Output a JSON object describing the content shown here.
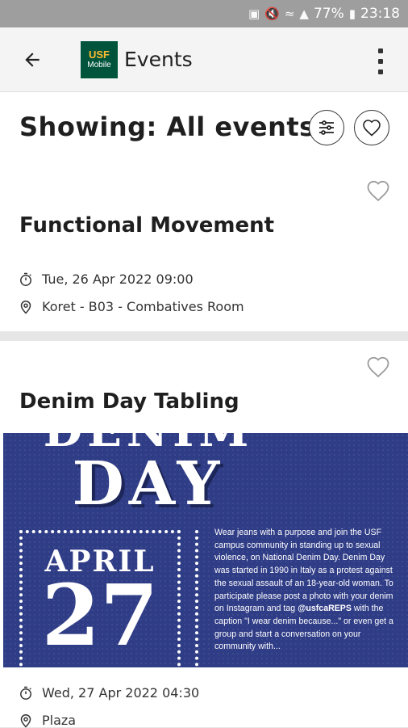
{
  "status_bar": {
    "battery": "77%",
    "time": "23:18"
  },
  "app_bar": {
    "logo_line1": "USF",
    "logo_line2": "Mobile",
    "title": "Events"
  },
  "header": {
    "showing": "Showing: All events"
  },
  "events": [
    {
      "title": "Functional Movement",
      "datetime": "Tue, 26 Apr 2022 09:00",
      "location": "Koret - B03 - Combatives Room"
    },
    {
      "title": "Denim Day Tabling",
      "datetime": "Wed, 27 Apr 2022 04:30",
      "location": "Plaza"
    }
  ],
  "poster": {
    "headline_partial": "DENIM",
    "headline": "DAY",
    "month": "APRIL",
    "day": "27",
    "body": "Wear jeans with a purpose and join the USF campus community in standing up to sexual violence, on National Denim Day. Denim Day was started in 1990 in Italy as a protest against the sexual assault of an 18-year-old woman. To participate please post a photo with your denim on Instagram and tag",
    "handle": "@usfcaREPS",
    "body2": "with the caption \"I wear denim because...\" or even get a group and start a conversation on your community with..."
  }
}
